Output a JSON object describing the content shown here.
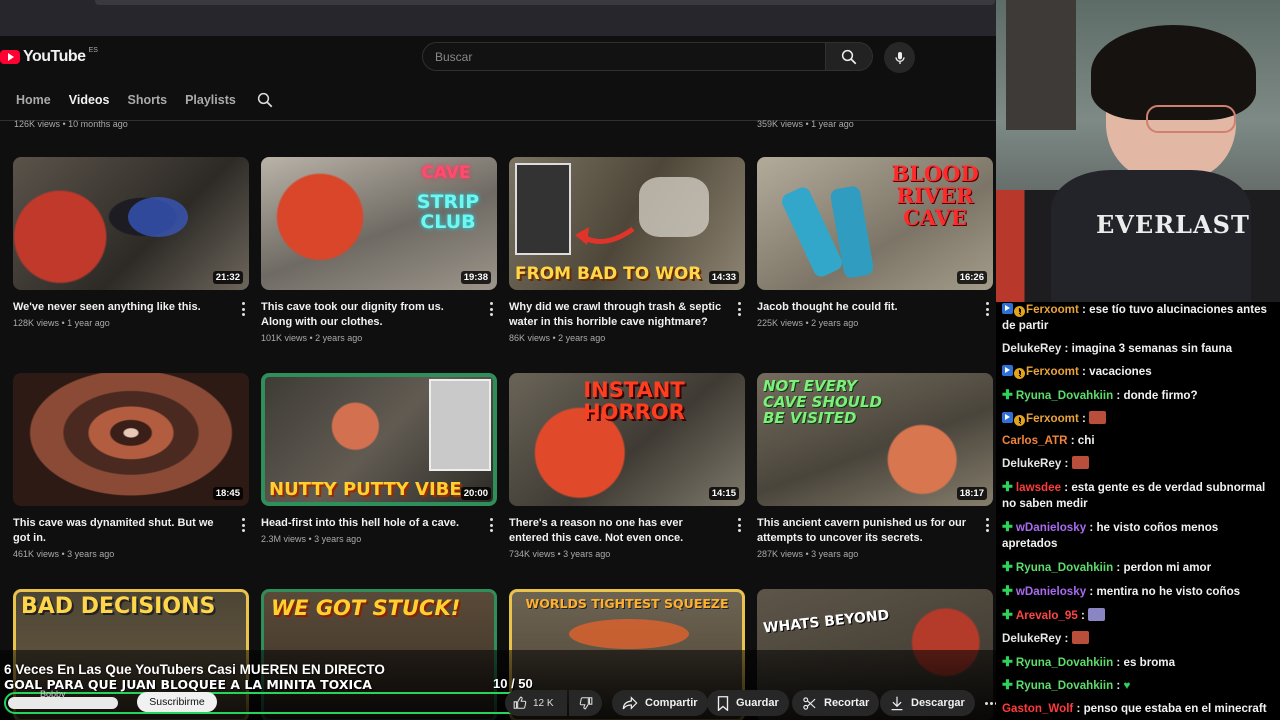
{
  "header": {
    "logo_text": "YouTube",
    "logo_region": "ES",
    "search_placeholder": "Buscar"
  },
  "channel_tabs": [
    "Home",
    "Videos",
    "Shorts",
    "Playlists"
  ],
  "active_tab": "Videos",
  "previous_row_meta": [
    "126K views • 10 months ago",
    "359K views • 1 year ago"
  ],
  "videos": [
    {
      "title": "We've never seen anything like this.",
      "meta": "128K views • 1 year ago",
      "duration": "21:32",
      "thumb_text": ""
    },
    {
      "title": "This cave took our dignity from us. Along with our clothes.",
      "meta": "101K views • 2 years ago",
      "duration": "19:38",
      "thumb_text": "CAVE STRIP CLUB"
    },
    {
      "title": "Why did we crawl through trash & septic water in this horrible cave nightmare?",
      "meta": "86K views • 2 years ago",
      "duration": "14:33",
      "thumb_text": "FROM BAD TO WOR"
    },
    {
      "title": "Jacob thought he could fit.",
      "meta": "225K views • 2 years ago",
      "duration": "16:26",
      "thumb_text": "BLOOD RIVER CAVE"
    },
    {
      "title": "This cave was dynamited shut. But we got in.",
      "meta": "461K views • 3 years ago",
      "duration": "18:45",
      "thumb_text": ""
    },
    {
      "title": "Head-first into this hell hole of a cave.",
      "meta": "2.3M views • 3 years ago",
      "duration": "20:00",
      "thumb_text": "NUTTY PUTTY VIBE"
    },
    {
      "title": "There's a reason no one has ever entered this cave. Not even once.",
      "meta": "734K views • 3 years ago",
      "duration": "14:15",
      "thumb_text": "INSTANT HORROR"
    },
    {
      "title": "This ancient cavern punished us for our attempts to uncover its secrets.",
      "meta": "287K views • 3 years ago",
      "duration": "18:17",
      "thumb_text": "NOT EVERY CAVE SHOULD BE VISITED"
    },
    {
      "title": "",
      "meta": "",
      "duration": "",
      "thumb_text": "BAD DECISIONS"
    },
    {
      "title": "",
      "meta": "",
      "duration": "",
      "thumb_text": "WE GOT STUCK!"
    },
    {
      "title": "",
      "meta": "",
      "duration": "",
      "thumb_text": "WORLDS TIGHTEST SQUEEZE"
    },
    {
      "title": "",
      "meta": "",
      "duration": "",
      "thumb_text": "WHATS BEYOND"
    }
  ],
  "stream": {
    "title": "6 Veces En Las Que YouTubers Casi MUEREN EN DIRECTO",
    "goal_text": "GOAL PARA QUE JUAN BLOQUEE A LA MINITA TOXICA",
    "goal_count": "10  / 50",
    "goal_progress": 0.2
  },
  "player_bar": {
    "channel_name": "Bobby",
    "subscribe_label": "Suscribirme",
    "like_count": "12 K",
    "share_label": "Compartir",
    "save_label": "Guardar",
    "clip_label": "Recortar",
    "download_label": "Descargar"
  },
  "chat": [
    {
      "user": "Ferxoomt",
      "color": "#e8a33a",
      "badges": [
        "prime",
        "coin"
      ],
      "text": " : ese tío tuvo alucinaciones antes de partir"
    },
    {
      "user": "DelukeRey",
      "color": "#e6e6e6",
      "badges": [],
      "text": " : imagina 3 semanas sin fauna"
    },
    {
      "user": "Ferxoomt",
      "color": "#e8a33a",
      "badges": [
        "prime",
        "coin"
      ],
      "text": " : vacaciones"
    },
    {
      "user": "Ryuna_Dovahkiin",
      "color": "#5ddc6c",
      "badges": [
        "plus"
      ],
      "text": " : donde firmo?"
    },
    {
      "user": "Ferxoomt",
      "color": "#e8a33a",
      "badges": [
        "prime",
        "coin"
      ],
      "text": " : ",
      "emote": "#b94f3a"
    },
    {
      "user": "Carlos_ATR",
      "color": "#f0843c",
      "badges": [],
      "text": " : chi"
    },
    {
      "user": "DelukeRey",
      "color": "#e6e6e6",
      "badges": [],
      "text": " : ",
      "emote": "#b94f3a"
    },
    {
      "user": "lawsdee",
      "color": "#ff3a3a",
      "badges": [
        "plus"
      ],
      "text": " : esta gente es de verdad subnormal no saben medir"
    },
    {
      "user": "wDanielosky",
      "color": "#a96af0",
      "badges": [
        "plus"
      ],
      "text": " : he visto coños menos apretados"
    },
    {
      "user": "Ryuna_Dovahkiin",
      "color": "#5ddc6c",
      "badges": [
        "plus"
      ],
      "text": " : perdon mi amor"
    },
    {
      "user": "wDanielosky",
      "color": "#a96af0",
      "badges": [
        "plus"
      ],
      "text": " : mentira no he visto coños"
    },
    {
      "user": "Arevalo_95",
      "color": "#ff4545",
      "badges": [
        "plus"
      ],
      "text": " : ",
      "emote": "#8a86c4"
    },
    {
      "user": "DelukeRey",
      "color": "#e6e6e6",
      "badges": [],
      "text": " : ",
      "emote": "#b94f3a"
    },
    {
      "user": "Ryuna_Dovahkiin",
      "color": "#5ddc6c",
      "badges": [
        "plus"
      ],
      "text": " : es broma"
    },
    {
      "user": "Ryuna_Dovahkiin",
      "color": "#5ddc6c",
      "badges": [
        "plus"
      ],
      "text": " : ",
      "heart": "♥"
    },
    {
      "user": "Gaston_Wolf",
      "color": "#ff3a3a",
      "badges": [],
      "text": " : penso que estaba en el minecraft"
    }
  ]
}
